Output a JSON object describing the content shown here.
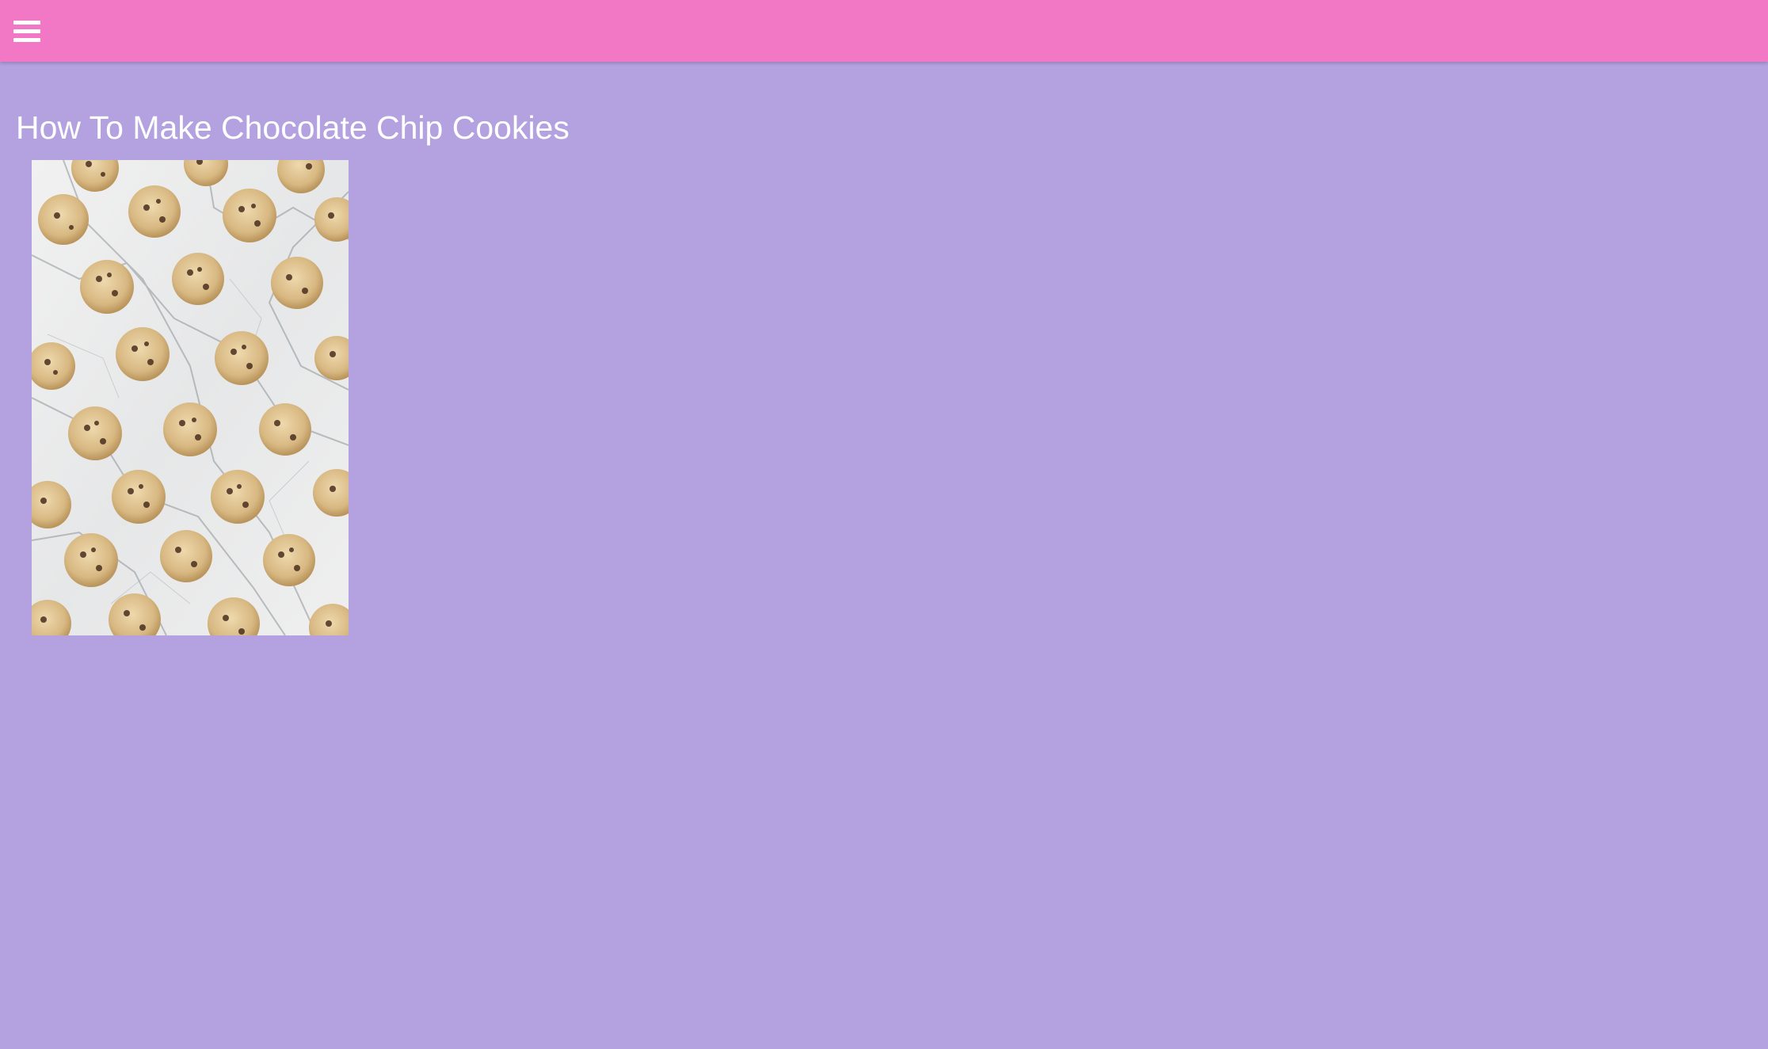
{
  "header": {
    "menu_icon": "hamburger-menu-icon",
    "background_color": "#f277c4"
  },
  "page": {
    "background_color": "#b3a1e0",
    "title": "How To Make Chocolate Chip Cookies",
    "title_color": "#ffffff"
  },
  "image": {
    "alt": "Chocolate chip cookies on marble"
  }
}
